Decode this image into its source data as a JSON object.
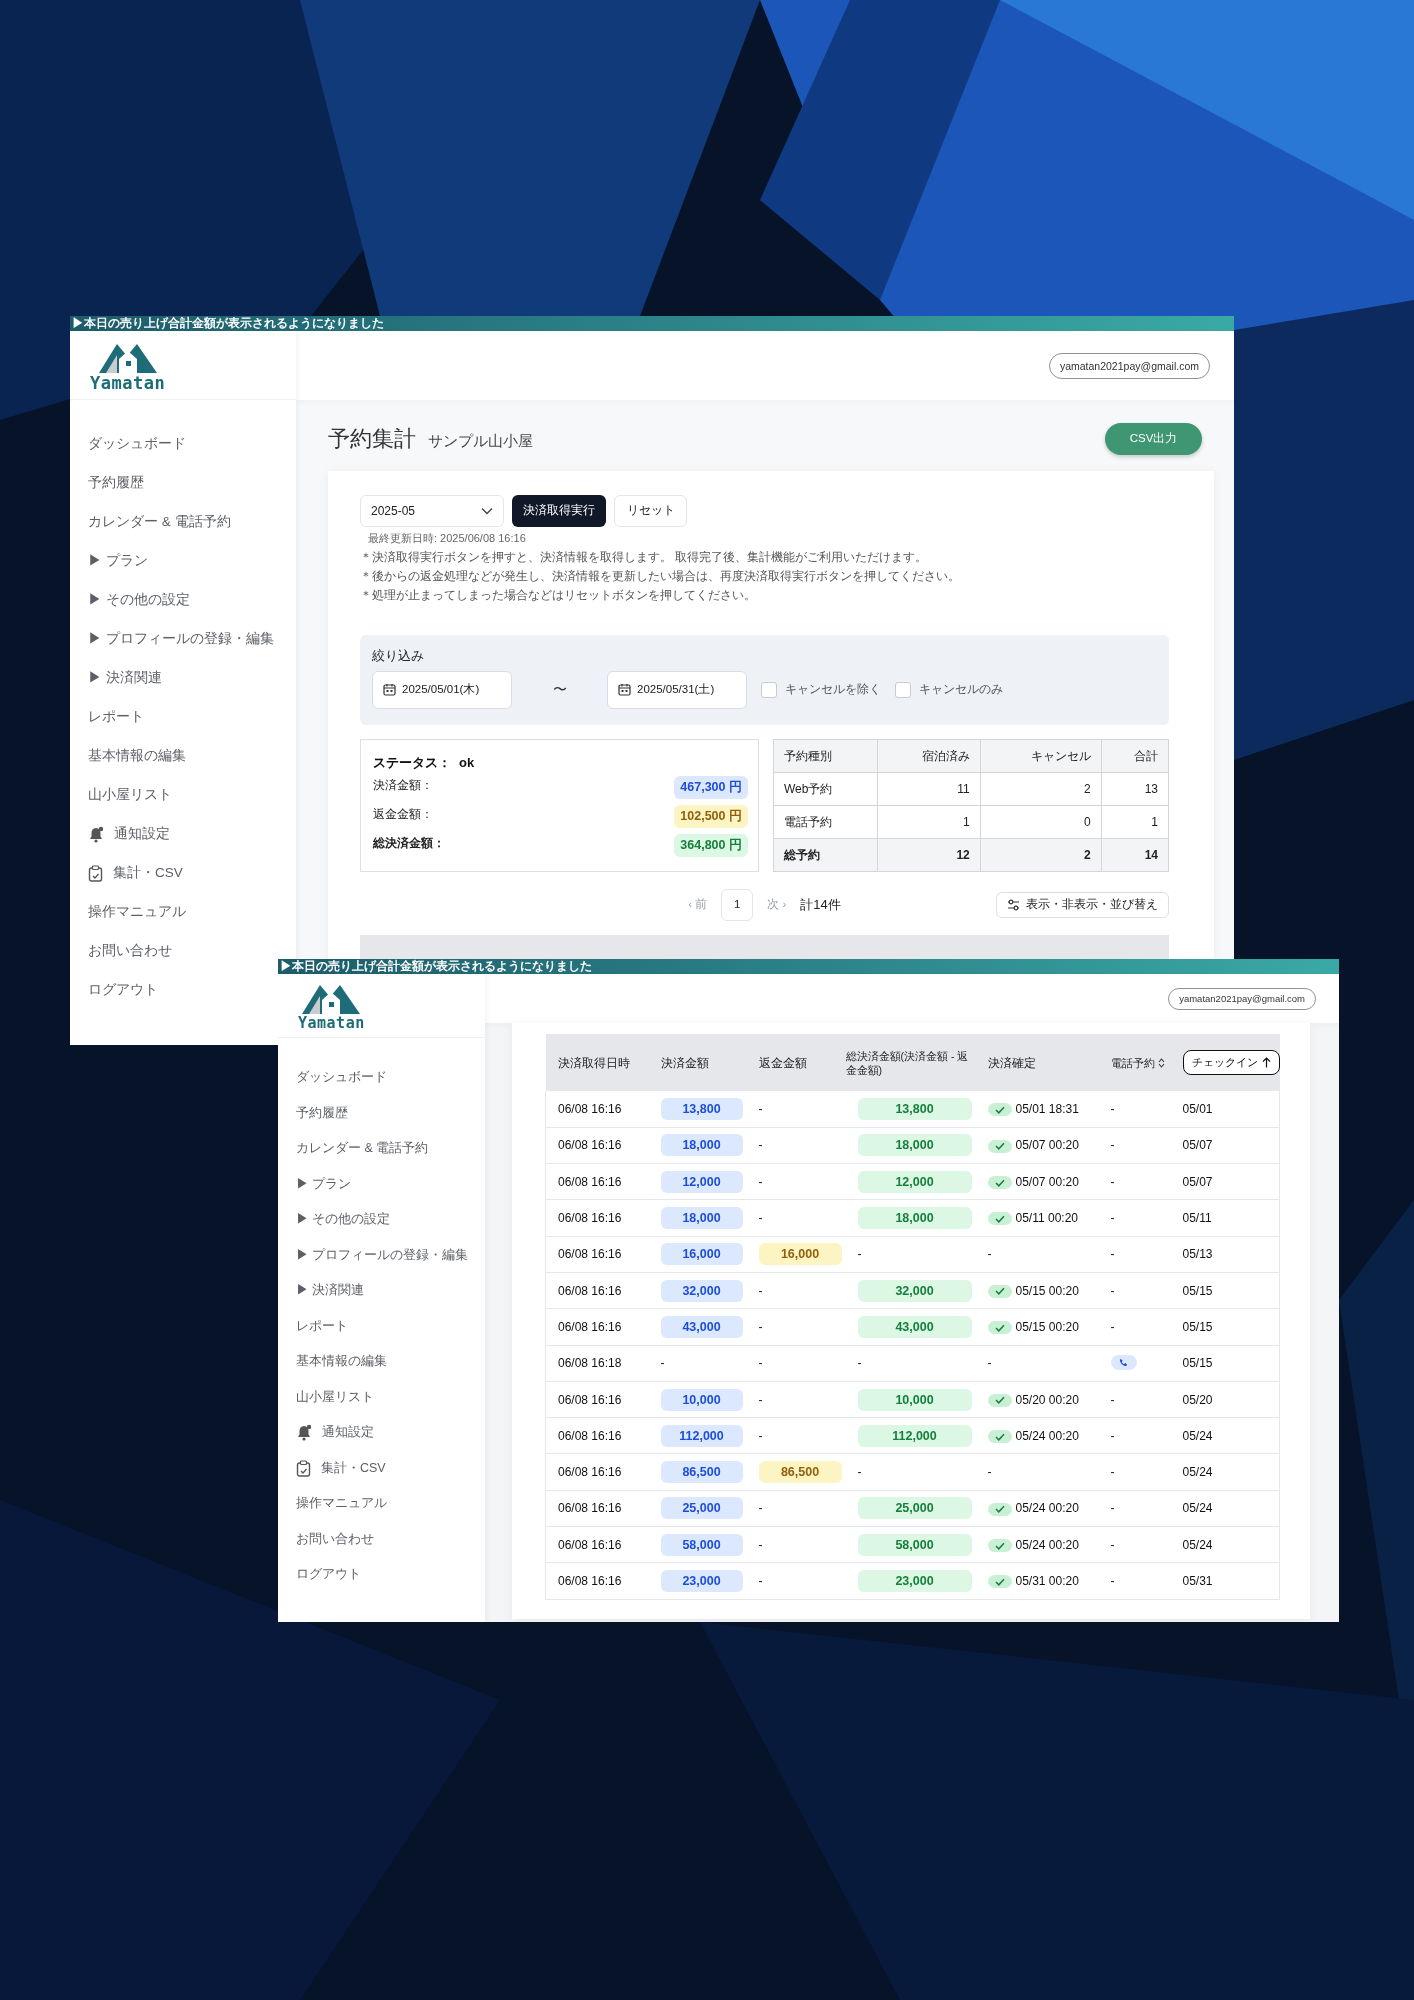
{
  "windows": [
    {
      "banner": "▶本日の売り上げ合計金額が表示されるようになりました",
      "logo": "Yamatan",
      "email": "yamatan2021pay@gmail.com",
      "sidebar": [
        {
          "label": "ダッシュボード"
        },
        {
          "label": "予約履歴"
        },
        {
          "label": "カレンダー & 電話予約"
        },
        {
          "label": "▶ プラン"
        },
        {
          "label": "▶ その他の設定"
        },
        {
          "label": "▶ プロフィールの登録・編集"
        },
        {
          "label": "▶ 決済関連"
        },
        {
          "label": "レポート"
        },
        {
          "label": "基本情報の編集"
        },
        {
          "label": "山小屋リスト"
        },
        {
          "label": "通知設定",
          "kind": "icon"
        },
        {
          "label": "集計・CSV",
          "kind": "icon"
        },
        {
          "label": "操作マニュアル"
        },
        {
          "label": "お問い合わせ"
        },
        {
          "label": "ログアウト"
        }
      ],
      "page": {
        "title": "予約集計",
        "subtitle": "サンプル山小屋",
        "export_button": "CSV出力",
        "month": "2025-05",
        "fetch_button": "決済取得実行",
        "reset_button": "リセット",
        "last_updated": "最終更新日時: 2025/06/08 16:16",
        "notes": [
          "＊決済取得実行ボタンを押すと、決済情報を取得します。 取得完了後、集計機能がご利用いただけます。",
          "＊後からの返金処理などが発生し、決済情報を更新したい場合は、再度決済取得実行ボタンを押してください。",
          "＊処理が止まってしまった場合などはリセットボタンを押してください。"
        ],
        "filter": {
          "label": "絞り込み",
          "from": "2025/05/01(木)",
          "separator": "〜",
          "to": "2025/05/31(土)",
          "checkboxes": [
            {
              "label": "キャンセルを除く",
              "checked": false
            },
            {
              "label": "キャンセルのみ",
              "checked": false
            }
          ]
        },
        "summary": {
          "status_label": "ステータス：",
          "status_value": "ok",
          "rows": [
            {
              "label": "決済金額：",
              "value": "467,300 円",
              "bold": false
            },
            {
              "label": "返金金額：",
              "value": "102,500 円",
              "bold": false
            },
            {
              "label": "総決済金額：",
              "value": "364,800 円",
              "bold": true
            }
          ]
        },
        "stats": {
          "columns": [
            "予約種別",
            "宿泊済み",
            "キャンセル",
            "合計"
          ],
          "rows": [
            {
              "cells": [
                "Web予約",
                "11",
                "2",
                "13"
              ],
              "total": false
            },
            {
              "cells": [
                "電話予約",
                "1",
                "0",
                "1"
              ],
              "total": false
            },
            {
              "cells": [
                "総予約",
                "12",
                "2",
                "14"
              ],
              "total": true
            }
          ]
        },
        "pagination": {
          "prev": "‹ 前",
          "prev_disabled": true,
          "page": "1",
          "next": "次 ›",
          "next_disabled": true,
          "total": "計14件"
        },
        "columns_button": "表示・非表示・並び替え"
      }
    },
    {
      "banner": "▶本日の売り上げ合計金額が表示されるようになりました",
      "logo": "Yamatan",
      "email": "yamatan2021pay@gmail.com",
      "sidebar": [
        {
          "label": "ダッシュボード"
        },
        {
          "label": "予約履歴"
        },
        {
          "label": "カレンダー & 電話予約"
        },
        {
          "label": "▶ プラン"
        },
        {
          "label": "▶ その他の設定"
        },
        {
          "label": "▶ プロフィールの登録・編集"
        },
        {
          "label": "▶ 決済関連"
        },
        {
          "label": "レポート"
        },
        {
          "label": "基本情報の編集"
        },
        {
          "label": "山小屋リスト"
        },
        {
          "label": "通知設定",
          "kind": "icon"
        },
        {
          "label": "集計・CSV",
          "kind": "icon"
        },
        {
          "label": "操作マニュアル"
        },
        {
          "label": "お問い合わせ"
        },
        {
          "label": "ログアウト"
        }
      ],
      "table": {
        "columns": [
          {
            "label": "決済取得日時"
          },
          {
            "label": "決済金額"
          },
          {
            "label": "返金金額"
          },
          {
            "label": "総決済金額(決済金額 - 返金金額)"
          },
          {
            "label": "決済確定"
          },
          {
            "label": "電話予約",
            "sortable": true,
            "sorted": false
          },
          {
            "label": "チェックイン",
            "sortable": true,
            "sorted": true
          }
        ],
        "rows": [
          [
            {
              "kind": "text",
              "text": "06/08 16:16"
            },
            {
              "kind": "badge",
              "text": "13,800"
            },
            {
              "kind": "text",
              "text": "-"
            },
            {
              "kind": "badge",
              "text": "13,800"
            },
            {
              "kind": "check",
              "text": "05/01 18:31"
            },
            {
              "kind": "text",
              "text": "-"
            },
            {
              "kind": "text",
              "text": "05/01"
            }
          ],
          [
            {
              "kind": "text",
              "text": "06/08 16:16"
            },
            {
              "kind": "badge",
              "text": "18,000"
            },
            {
              "kind": "text",
              "text": "-"
            },
            {
              "kind": "badge",
              "text": "18,000"
            },
            {
              "kind": "check",
              "text": "05/07 00:20"
            },
            {
              "kind": "text",
              "text": "-"
            },
            {
              "kind": "text",
              "text": "05/07"
            }
          ],
          [
            {
              "kind": "text",
              "text": "06/08 16:16"
            },
            {
              "kind": "badge",
              "text": "12,000"
            },
            {
              "kind": "text",
              "text": "-"
            },
            {
              "kind": "badge",
              "text": "12,000"
            },
            {
              "kind": "check",
              "text": "05/07 00:20"
            },
            {
              "kind": "text",
              "text": "-"
            },
            {
              "kind": "text",
              "text": "05/07"
            }
          ],
          [
            {
              "kind": "text",
              "text": "06/08 16:16"
            },
            {
              "kind": "badge",
              "text": "18,000"
            },
            {
              "kind": "text",
              "text": "-"
            },
            {
              "kind": "badge",
              "text": "18,000"
            },
            {
              "kind": "check",
              "text": "05/11 00:20"
            },
            {
              "kind": "text",
              "text": "-"
            },
            {
              "kind": "text",
              "text": "05/11"
            }
          ],
          [
            {
              "kind": "text",
              "text": "06/08 16:16"
            },
            {
              "kind": "badge",
              "text": "16,000"
            },
            {
              "kind": "badge",
              "text": "16,000"
            },
            {
              "kind": "text",
              "text": "-"
            },
            {
              "kind": "text",
              "text": "-"
            },
            {
              "kind": "text",
              "text": "-"
            },
            {
              "kind": "text",
              "text": "05/13"
            }
          ],
          [
            {
              "kind": "text",
              "text": "06/08 16:16"
            },
            {
              "kind": "badge",
              "text": "32,000"
            },
            {
              "kind": "text",
              "text": "-"
            },
            {
              "kind": "badge",
              "text": "32,000"
            },
            {
              "kind": "check",
              "text": "05/15 00:20"
            },
            {
              "kind": "text",
              "text": "-"
            },
            {
              "kind": "text",
              "text": "05/15"
            }
          ],
          [
            {
              "kind": "text",
              "text": "06/08 16:16"
            },
            {
              "kind": "badge",
              "text": "43,000"
            },
            {
              "kind": "text",
              "text": "-"
            },
            {
              "kind": "badge",
              "text": "43,000"
            },
            {
              "kind": "check",
              "text": "05/15 00:20"
            },
            {
              "kind": "text",
              "text": "-"
            },
            {
              "kind": "text",
              "text": "05/15"
            }
          ],
          [
            {
              "kind": "text",
              "text": "06/08 16:18"
            },
            {
              "kind": "text",
              "text": "-"
            },
            {
              "kind": "text",
              "text": "-"
            },
            {
              "kind": "text",
              "text": "-"
            },
            {
              "kind": "text",
              "text": "-"
            },
            {
              "kind": "phone"
            },
            {
              "kind": "text",
              "text": "05/15"
            }
          ],
          [
            {
              "kind": "text",
              "text": "06/08 16:16"
            },
            {
              "kind": "badge",
              "text": "10,000"
            },
            {
              "kind": "text",
              "text": "-"
            },
            {
              "kind": "badge",
              "text": "10,000"
            },
            {
              "kind": "check",
              "text": "05/20 00:20"
            },
            {
              "kind": "text",
              "text": "-"
            },
            {
              "kind": "text",
              "text": "05/20"
            }
          ],
          [
            {
              "kind": "text",
              "text": "06/08 16:16"
            },
            {
              "kind": "badge",
              "text": "112,000"
            },
            {
              "kind": "text",
              "text": "-"
            },
            {
              "kind": "badge",
              "text": "112,000"
            },
            {
              "kind": "check",
              "text": "05/24 00:20"
            },
            {
              "kind": "text",
              "text": "-"
            },
            {
              "kind": "text",
              "text": "05/24"
            }
          ],
          [
            {
              "kind": "text",
              "text": "06/08 16:16"
            },
            {
              "kind": "badge",
              "text": "86,500"
            },
            {
              "kind": "badge",
              "text": "86,500"
            },
            {
              "kind": "text",
              "text": "-"
            },
            {
              "kind": "text",
              "text": "-"
            },
            {
              "kind": "text",
              "text": "-"
            },
            {
              "kind": "text",
              "text": "05/24"
            }
          ],
          [
            {
              "kind": "text",
              "text": "06/08 16:16"
            },
            {
              "kind": "badge",
              "text": "25,000"
            },
            {
              "kind": "text",
              "text": "-"
            },
            {
              "kind": "badge",
              "text": "25,000"
            },
            {
              "kind": "check",
              "text": "05/24 00:20"
            },
            {
              "kind": "text",
              "text": "-"
            },
            {
              "kind": "text",
              "text": "05/24"
            }
          ],
          [
            {
              "kind": "text",
              "text": "06/08 16:16"
            },
            {
              "kind": "badge",
              "text": "58,000"
            },
            {
              "kind": "text",
              "text": "-"
            },
            {
              "kind": "badge",
              "text": "58,000"
            },
            {
              "kind": "check",
              "text": "05/24 00:20"
            },
            {
              "kind": "text",
              "text": "-"
            },
            {
              "kind": "text",
              "text": "05/24"
            }
          ],
          [
            {
              "kind": "text",
              "text": "06/08 16:16"
            },
            {
              "kind": "badge",
              "text": "23,000"
            },
            {
              "kind": "text",
              "text": "-"
            },
            {
              "kind": "badge",
              "text": "23,000"
            },
            {
              "kind": "check",
              "text": "05/31 00:20"
            },
            {
              "kind": "text",
              "text": "-"
            },
            {
              "kind": "text",
              "text": "05/31"
            }
          ]
        ]
      }
    }
  ]
}
